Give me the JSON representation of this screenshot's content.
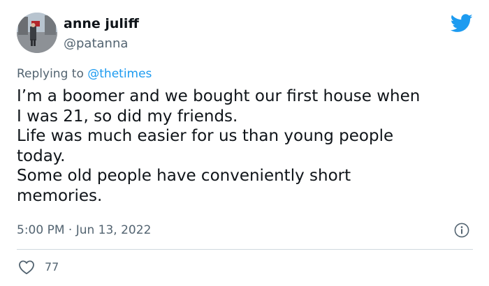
{
  "author": {
    "display_name": "anne juliff",
    "handle": "@patanna"
  },
  "reply": {
    "prefix": "Replying to",
    "mention": "@thetimes"
  },
  "tweet_lines": [
    "I’m a boomer and we bought our first house when",
    "I was 21, so did my friends.",
    "Life was much easier for us than young people",
    "today.",
    "Some old people have conveniently short",
    "memories."
  ],
  "timestamp": "5:00 PM · Jun 13, 2022",
  "likes": "77",
  "icons": {
    "brand": "twitter-bird-icon",
    "info": "info-icon",
    "like": "heart-icon"
  },
  "colors": {
    "brand_blue": "#1d9bf0",
    "text": "#0f1419",
    "secondary": "#536471",
    "divider": "#cfd9de"
  }
}
